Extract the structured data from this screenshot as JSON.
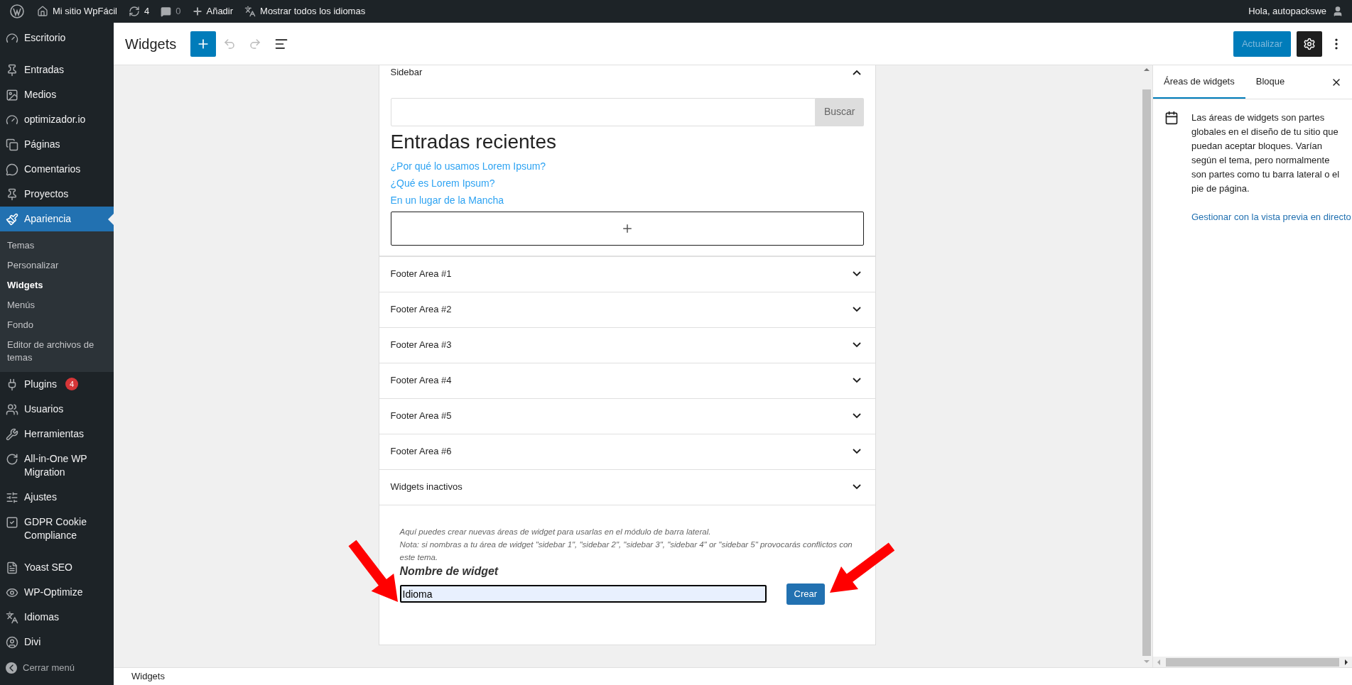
{
  "admin_bar": {
    "site": "Mi sitio WpFácil",
    "updates": "4",
    "comments": "0",
    "new": "Añadir",
    "languages": "Mostrar todos los idiomas",
    "greeting": "Hola, autopackswe"
  },
  "menu": {
    "groups": [
      [
        {
          "label": "Escritorio",
          "selected": false
        }
      ],
      [
        {
          "label": "Entradas",
          "selected": false
        },
        {
          "label": "Medios",
          "selected": false
        },
        {
          "label": "optimizador.io",
          "selected": false
        },
        {
          "label": "Páginas",
          "selected": false
        },
        {
          "label": "Comentarios",
          "selected": false
        },
        {
          "label": "Proyectos",
          "selected": false
        },
        {
          "label": "Apariencia",
          "selected": true,
          "children": [
            {
              "label": "Temas",
              "selected": false
            },
            {
              "label": "Personalizar",
              "selected": false
            },
            {
              "label": "Widgets",
              "selected": true
            },
            {
              "label": "Menús",
              "selected": false
            },
            {
              "label": "Fondo",
              "selected": false
            },
            {
              "label": "Editor de archivos de temas",
              "selected": false
            }
          ]
        },
        {
          "label": "Plugins",
          "selected": false,
          "badge": "4"
        },
        {
          "label": "Usuarios",
          "selected": false
        },
        {
          "label": "Herramientas",
          "selected": false
        },
        {
          "label": "All-in-One WP Migration",
          "selected": false
        },
        {
          "label": "Ajustes",
          "selected": false
        },
        {
          "label": "GDPR Cookie Compliance",
          "selected": false
        }
      ],
      [
        {
          "label": "Yoast SEO",
          "selected": false
        },
        {
          "label": "WP-Optimize",
          "selected": false
        },
        {
          "label": "Idiomas",
          "selected": false
        },
        {
          "label": "Divi",
          "selected": false
        }
      ]
    ],
    "collapse": "Cerrar menú"
  },
  "header": {
    "title": "Widgets",
    "update_button": {
      "label": "Actualizar",
      "disabled": true
    }
  },
  "sidebar_area": {
    "title": "Sidebar",
    "expanded": true,
    "search_button": "Buscar",
    "heading": "Entradas recientes",
    "links": [
      "¿Por qué lo usamos Lorem Ipsum?",
      "¿Qué es Lorem Ipsum?",
      "En un lugar de la Mancha"
    ]
  },
  "areas": [
    {
      "title": "Footer Area #1",
      "expanded": false
    },
    {
      "title": "Footer Area #2",
      "expanded": false
    },
    {
      "title": "Footer Area #3",
      "expanded": false
    },
    {
      "title": "Footer Area #4",
      "expanded": false
    },
    {
      "title": "Footer Area #5",
      "expanded": false
    },
    {
      "title": "Footer Area #6",
      "expanded": false
    },
    {
      "title": "Widgets inactivos",
      "expanded": false
    }
  ],
  "create_form": {
    "notes": [
      "Aquí puedes crear nuevas áreas de widget para usarlas en el módulo de barra lateral.",
      "Nota: si nombras a tu área de widget \"sidebar 1\", \"sidebar 2\", \"sidebar 3\", \"sidebar 4\" or \"sidebar 5\" provocarás conflictos con este tema."
    ],
    "label": "Nombre de widget",
    "value": "Idioma",
    "button": "Crear"
  },
  "settings_panel": {
    "tabs": [
      {
        "label": "Áreas de widgets",
        "selected": true
      },
      {
        "label": "Bloque",
        "selected": false
      }
    ],
    "description": "Las áreas de widgets son partes globales en el diseño de tu sitio que puedan aceptar bloques. Varían según el tema, pero normalmente son partes como tu barra lateral o el pie de página.",
    "link": "Gestionar con la vista previa en directo"
  },
  "footer": {
    "breadcrumb": "Widgets"
  }
}
